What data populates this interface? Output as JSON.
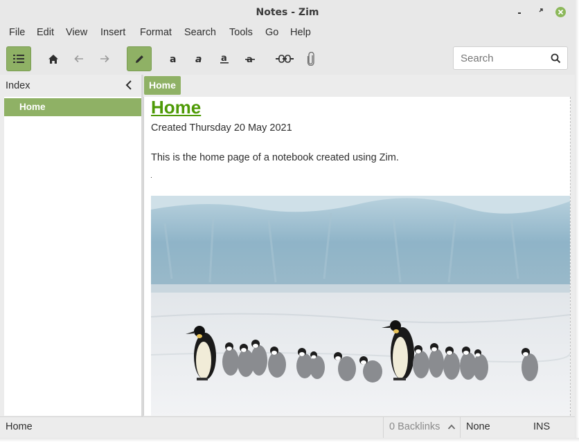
{
  "window": {
    "title": "Notes - Zim",
    "accent_color": "#8fb165",
    "link_color": "#4e9a06"
  },
  "menubar": {
    "items": [
      {
        "label": "File"
      },
      {
        "label": "Edit"
      },
      {
        "label": "View"
      },
      {
        "label": "Insert"
      },
      {
        "label": "Format"
      },
      {
        "label": "Search"
      },
      {
        "label": "Tools"
      },
      {
        "label": "Go"
      },
      {
        "label": "Help"
      }
    ]
  },
  "toolbar": {
    "buttons": [
      {
        "name": "toggle-index-button",
        "icon": "list-icon",
        "active": true
      },
      {
        "name": "home-button",
        "icon": "home-icon",
        "active": false
      },
      {
        "name": "back-button",
        "icon": "arrow-left-icon",
        "active": false
      },
      {
        "name": "forward-button",
        "icon": "arrow-right-icon",
        "active": false
      },
      {
        "name": "edit-mode-button",
        "icon": "pencil-icon",
        "active": true
      },
      {
        "name": "bold-button",
        "icon": "bold-icon",
        "active": false
      },
      {
        "name": "italic-button",
        "icon": "italic-icon",
        "active": false
      },
      {
        "name": "underline-button",
        "icon": "underline-icon",
        "active": false
      },
      {
        "name": "strikethrough-button",
        "icon": "strikethrough-icon",
        "active": false
      },
      {
        "name": "insert-link-button",
        "icon": "link-icon",
        "active": false
      },
      {
        "name": "attach-file-button",
        "icon": "paperclip-icon",
        "active": false
      }
    ],
    "search": {
      "placeholder": "Search",
      "value": ""
    }
  },
  "sidebar": {
    "title": "Index",
    "items": [
      {
        "label": "Home",
        "selected": true
      }
    ]
  },
  "pathbar": {
    "crumbs": [
      {
        "label": "Home"
      }
    ]
  },
  "page": {
    "heading": "Home",
    "created": "Created Thursday 20 May 2021",
    "paragraph": "This is the home page of a notebook created using Zim.",
    "image_subject": "emperor penguins walking on snow"
  },
  "statusbar": {
    "page": "Home",
    "backlinks": "0 Backlinks",
    "style": "None",
    "mode": "INS"
  }
}
